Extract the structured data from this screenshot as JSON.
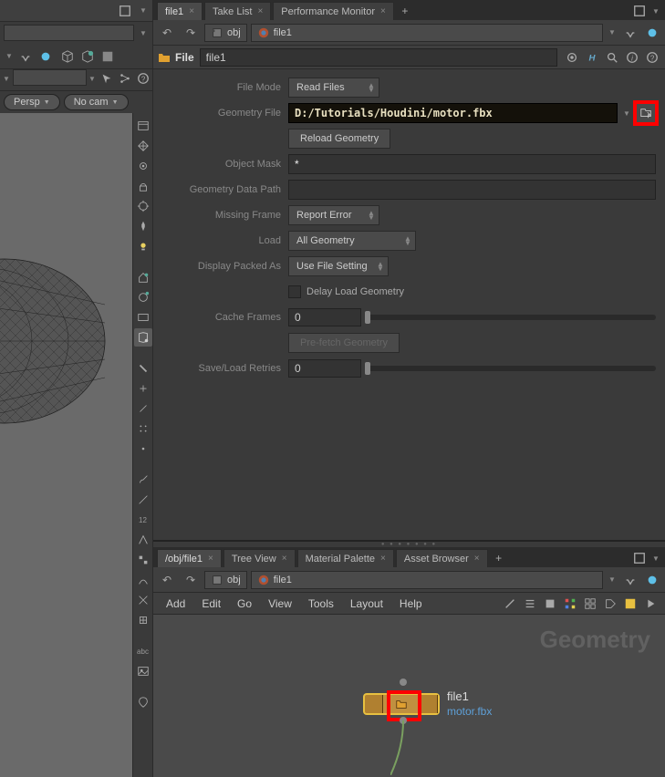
{
  "tabs_top": [
    {
      "label": "file1",
      "active": true
    },
    {
      "label": "Take List",
      "active": false
    },
    {
      "label": "Performance Monitor",
      "active": false
    }
  ],
  "tabs_network": [
    {
      "label": "/obj/file1",
      "active": true
    },
    {
      "label": "Tree View",
      "active": false
    },
    {
      "label": "Material Palette",
      "active": false
    },
    {
      "label": "Asset Browser",
      "active": false
    }
  ],
  "path_top": {
    "folder": "obj",
    "node": "file1"
  },
  "path_bottom": {
    "folder": "obj",
    "node": "file1"
  },
  "viewport": {
    "persp": "Persp",
    "cam": "No cam"
  },
  "node": {
    "type": "File",
    "name": "file1"
  },
  "side_lbl_abc": "abc",
  "side_lbl_12": "12",
  "params": {
    "file_mode_label": "File Mode",
    "file_mode_value": "Read Files",
    "geometry_file_label": "Geometry File",
    "geometry_file_value": "D:/Tutorials/Houdini/motor.fbx",
    "reload_label": "Reload Geometry",
    "object_mask_label": "Object Mask",
    "object_mask_value": "*",
    "geom_data_path_label": "Geometry Data Path",
    "geom_data_path_value": "",
    "missing_frame_label": "Missing Frame",
    "missing_frame_value": "Report Error",
    "load_label": "Load",
    "load_value": "All Geometry",
    "display_packed_label": "Display Packed As",
    "display_packed_value": "Use File Setting",
    "delay_load_label": "Delay Load Geometry",
    "cache_frames_label": "Cache Frames",
    "cache_frames_value": "0",
    "prefetch_label": "Pre-fetch Geometry",
    "retries_label": "Save/Load Retries",
    "retries_value": "0"
  },
  "network": {
    "context_label": "Geometry",
    "menus": [
      "Add",
      "Edit",
      "Go",
      "View",
      "Tools",
      "Layout",
      "Help"
    ],
    "node_name": "file1",
    "node_file": "motor.fbx"
  }
}
